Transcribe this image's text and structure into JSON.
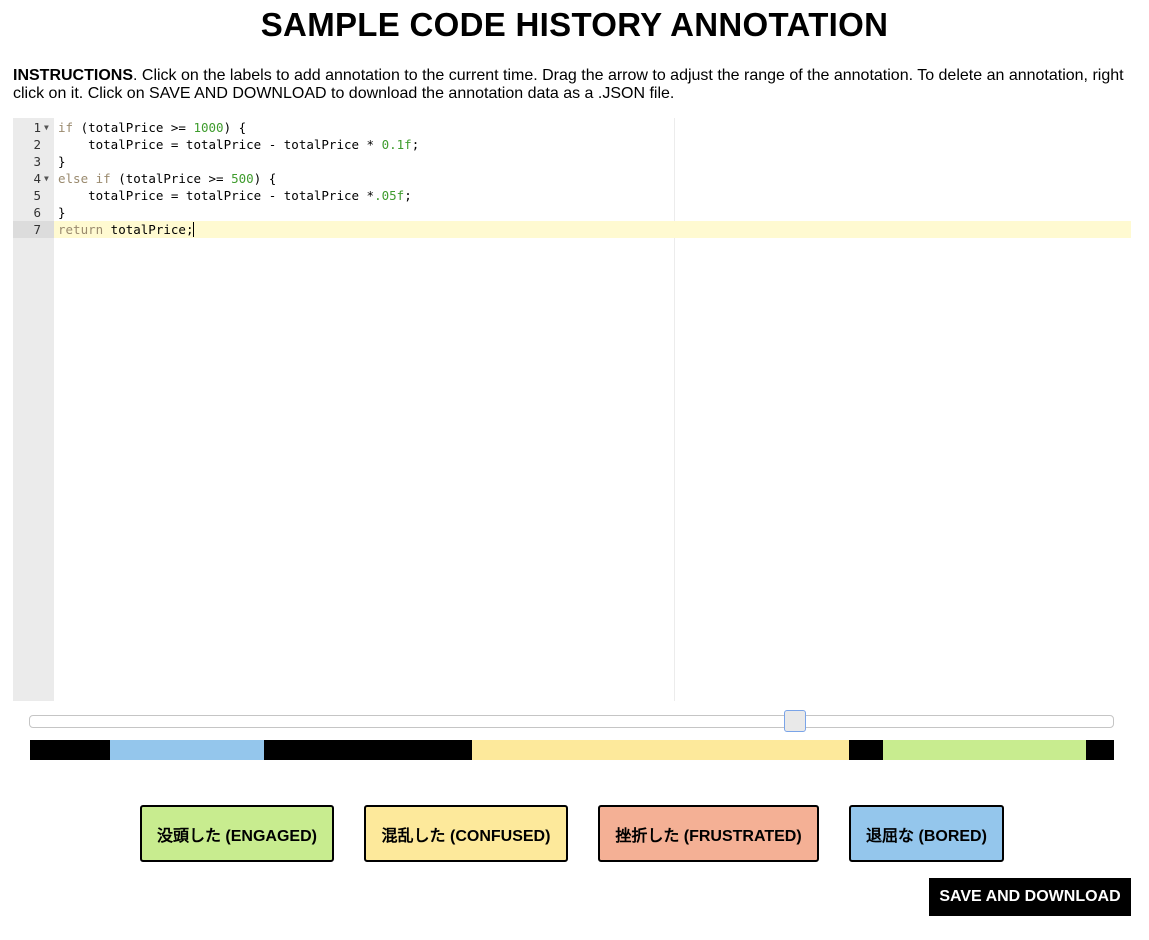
{
  "title": "SAMPLE CODE HISTORY ANNOTATION",
  "instructions": {
    "label": "INSTRUCTIONS",
    "text": ". Click on the labels to add annotation to the current time. Drag the arrow to adjust the range of the annotation. To delete an annotation, right click on it. Click on SAVE AND DOWNLOAD to download the annotation data as a .JSON file."
  },
  "editor": {
    "line_numbers": [
      "1",
      "2",
      "3",
      "4",
      "5",
      "6",
      "7"
    ],
    "active_line": 7
  },
  "timeline": {
    "slider_position": 0.71,
    "segments": [
      {
        "label": "black",
        "color": "#000000"
      },
      {
        "label": "BORED",
        "color": "#94c6ec"
      },
      {
        "label": "black",
        "color": "#000000"
      },
      {
        "label": "CONFUSED",
        "color": "#fde99b"
      },
      {
        "label": "black",
        "color": "#000000"
      },
      {
        "label": "ENGAGED",
        "color": "#c8ec8f"
      },
      {
        "label": "black",
        "color": "#000000"
      }
    ]
  },
  "labels": {
    "engaged": {
      "text": "没頭した (ENGAGED)",
      "color": "#c8ec8f"
    },
    "confused": {
      "text": "混乱した (CONFUSED)",
      "color": "#fde99b"
    },
    "frustrated": {
      "text": "挫折した (FRUSTRATED)",
      "color": "#f4b095"
    },
    "bored": {
      "text": "退屈な (BORED)",
      "color": "#94c6ec"
    }
  },
  "save_button": "SAVE AND DOWNLOAD"
}
